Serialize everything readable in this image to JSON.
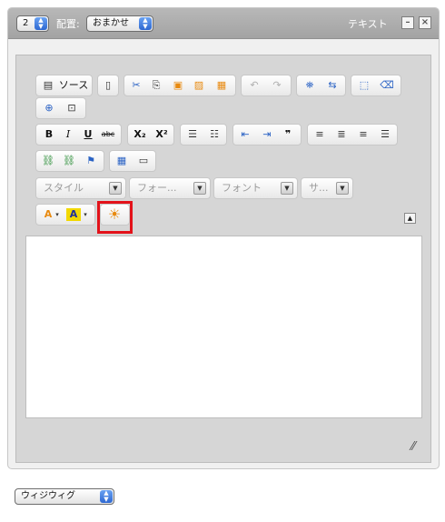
{
  "header": {
    "column_count": "2",
    "placement_label": "配置:",
    "placement_value": "おまかせ",
    "widget_title": "テキスト",
    "minimize_glyph": "–",
    "close_glyph": "×"
  },
  "toolbar": {
    "source_label": "ソース",
    "bold": "B",
    "italic": "I",
    "underline": "U",
    "strike": "abc",
    "subscript": "X₂",
    "superscript": "X²",
    "blockquote": "❞",
    "styles": {
      "style": "スタイル",
      "format": "フォー...",
      "font": "フォント",
      "size": "サ..."
    },
    "text_color_letter": "A",
    "bg_color_letter": "A"
  },
  "mode_select": {
    "value": "ウィジウィグ"
  },
  "colors": {
    "highlight": "#e3121a",
    "header_bg": "#aaaaaa",
    "select_arrow": "#2e68d1"
  }
}
